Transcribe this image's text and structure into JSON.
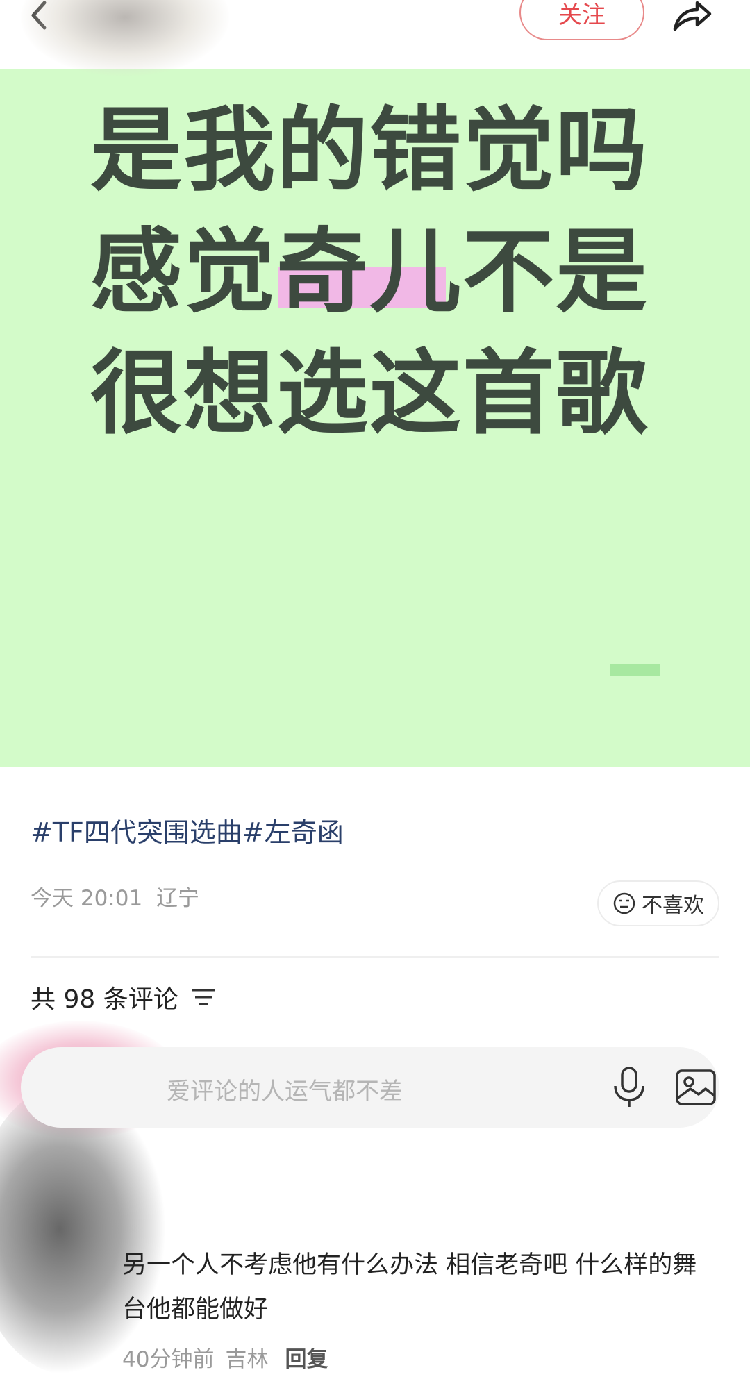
{
  "header": {
    "follow_label": "关注"
  },
  "post": {
    "image_lines": [
      "是我的错觉吗",
      "感觉奇儿不是",
      "很想选这首歌"
    ],
    "image_bg_color": "#d3fbc9",
    "highlight_color": "#f1b8e6",
    "hashtags": "#TF四代突围选曲#左奇函",
    "time": "今天 20:01",
    "location": "辽宁",
    "dislike_label": "不喜欢"
  },
  "comments": {
    "count_text": "共 98 条评论",
    "input_placeholder": "爱评论的人运气都不差",
    "items": [
      {
        "text": "另一个人不考虑他有什么办法 相信老奇吧 什么样的舞台他都能做好",
        "time": "40分钟前",
        "location": "吉林",
        "reply_label": "回复"
      }
    ]
  },
  "icons": [
    "chevron-left-icon",
    "share-icon",
    "neutral-face-icon",
    "sort-icon",
    "mic-icon",
    "image-icon"
  ]
}
